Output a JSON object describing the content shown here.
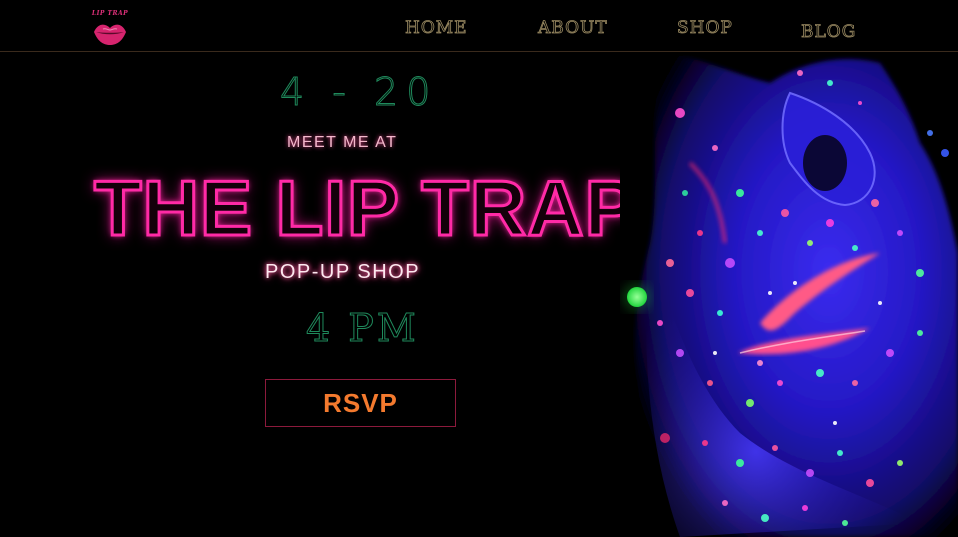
{
  "header": {
    "logo_text": "LIP TRAP",
    "nav": [
      {
        "label": "HOME"
      },
      {
        "label": "ABOUT"
      },
      {
        "label": "SHOP"
      },
      {
        "label": "BLOG"
      }
    ]
  },
  "hero": {
    "date": "4 - 20",
    "meet": "MEET ME AT",
    "title": "THE LIP TRAP",
    "subtitle": "POP-UP SHOP",
    "time": "4 PM",
    "rsvp_label": "RSVP"
  },
  "colors": {
    "background": "#000000",
    "neon_pink": "#ff2aa6",
    "neon_green": "#1f8a5c",
    "nav_gold": "#9a8a62",
    "rsvp_orange": "#f47a2e",
    "rsvp_border": "#8c1a3c",
    "face_blue": "#2a1fd8"
  },
  "icons": {
    "logo": "lips-logo-icon"
  }
}
